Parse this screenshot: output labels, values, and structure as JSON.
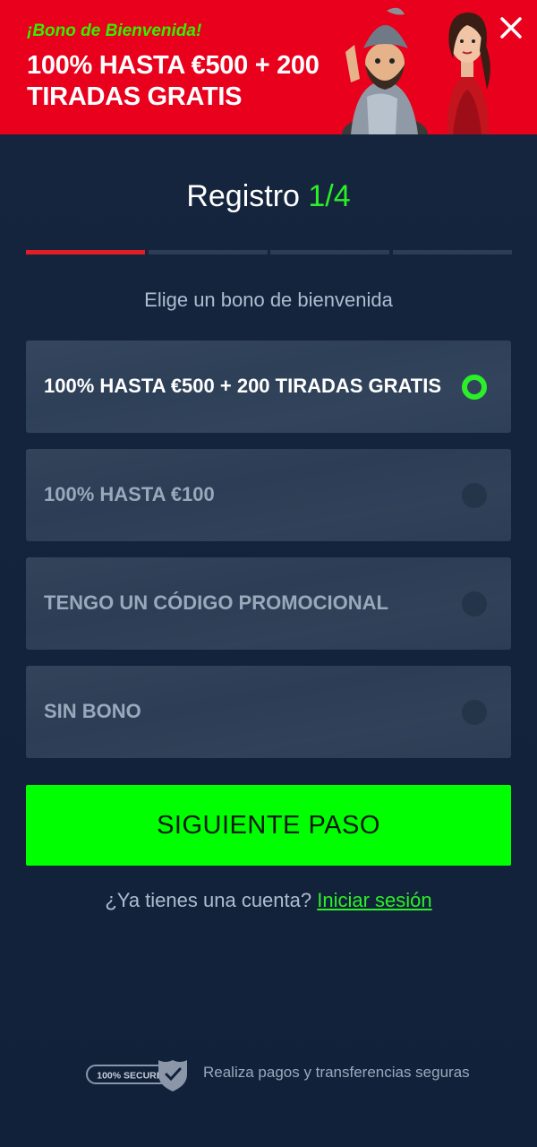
{
  "banner": {
    "eyebrow": "¡Bono de Bienvenida!",
    "title": "100% HASTA €500 + 200 TIRADAS GRATIS",
    "background_color": "#e8001c",
    "close_icon": "close-icon"
  },
  "registration": {
    "title": "Registro",
    "step": "1/4",
    "progress_current_step": 1,
    "progress_total_steps": 4,
    "subtitle": "Elige un bono de bienvenida"
  },
  "options": [
    {
      "label": "100% HASTA €500 + 200 TIRADAS GRATIS",
      "selected": true
    },
    {
      "label": "100% HASTA €100",
      "selected": false
    },
    {
      "label": "TENGO UN CÓDIGO PROMOCIONAL",
      "selected": false
    },
    {
      "label": "SIN BONO",
      "selected": false
    }
  ],
  "next_button": {
    "label": "SIGUIENTE PASO",
    "color": "#00ff00"
  },
  "login": {
    "prompt": "¿Ya tienes una cuenta?",
    "link": "Iniciar sesión"
  },
  "footer": {
    "badge": "100% SECURE",
    "text": "Realiza pagos y transferencias seguras"
  },
  "colors": {
    "accent_green": "#2bef28",
    "progress_active": "#e31d24",
    "background": "#12213a"
  }
}
